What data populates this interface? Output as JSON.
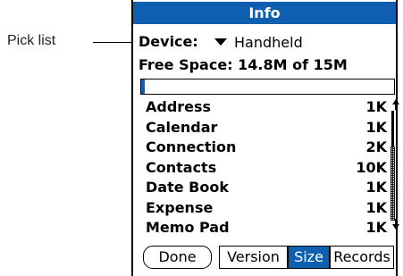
{
  "callout": {
    "label": "Pick list"
  },
  "window": {
    "title": "Info"
  },
  "device": {
    "label": "Device:",
    "value": "Handheld"
  },
  "free_space": {
    "label": "Free Space: 14.8M of 15M",
    "used_fraction": 0.013
  },
  "apps": [
    {
      "name": "Address",
      "size": "1K"
    },
    {
      "name": "Calendar",
      "size": "1K"
    },
    {
      "name": "Connection",
      "size": "2K"
    },
    {
      "name": "Contacts",
      "size": "10K"
    },
    {
      "name": "Date Book",
      "size": "1K"
    },
    {
      "name": "Expense",
      "size": "1K"
    },
    {
      "name": "Memo Pad",
      "size": "1K"
    }
  ],
  "buttons": {
    "done": "Done",
    "version": "Version",
    "size": "Size",
    "records": "Records",
    "selected": "Size"
  },
  "colors": {
    "accent": "#0e5fb0"
  }
}
